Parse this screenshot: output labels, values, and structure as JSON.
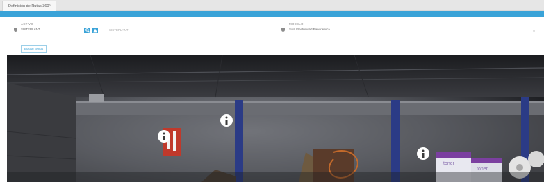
{
  "tabs": [
    {
      "label": "Definición de Rutas 360º"
    }
  ],
  "form": {
    "activo": {
      "label": "ACTIVO",
      "value": "SISTEPLANT",
      "description": "SISTEPLANT"
    },
    "modelo": {
      "label": "MODELO",
      "value": "Sala Electricidad Panorámica"
    },
    "search_button_icon": "search-icon",
    "warning_button_icon": "warning-icon",
    "add_button_label": "Buscar textos"
  },
  "panorama": {
    "hotspot_icon": "info-icon",
    "box_labels": [
      "toner",
      "toner"
    ]
  },
  "colors": {
    "accent": "#3aa3d8",
    "tab_bar": "#e6e6e6"
  }
}
